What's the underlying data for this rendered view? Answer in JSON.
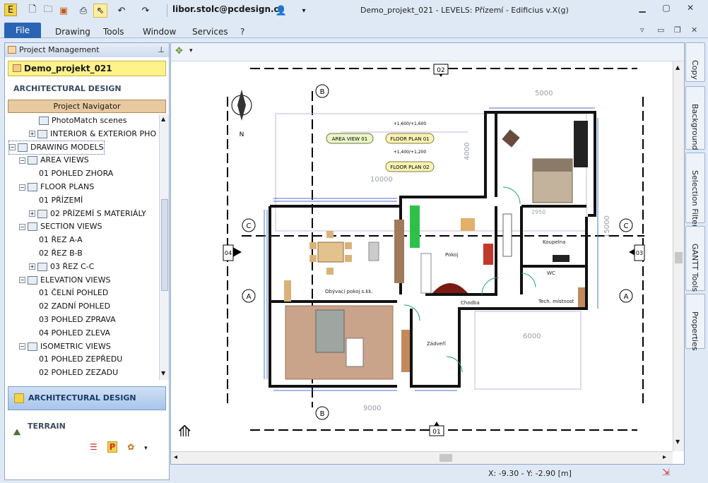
{
  "window": {
    "user": "libor.stolc@pcdesign.cz",
    "title": "Demo_projekt_021 -  LEVELS: Přízemí - Edificius v.X(g)"
  },
  "menu": [
    "File",
    "Drawing",
    "Tools",
    "Window",
    "Services",
    "?"
  ],
  "panel": {
    "header": "Project Management",
    "project": "Demo_projekt_021",
    "section": "ARCHITECTURAL DESIGN",
    "navigator": "Project Navigator",
    "tree": [
      {
        "label": "PhotoMatch scenes",
        "indent": 3,
        "exp": ""
      },
      {
        "label": "INTERIOR & EXTERIOR PHO",
        "indent": 2,
        "exp": "+"
      },
      {
        "label": "DRAWING MODELS",
        "indent": 0,
        "exp": "-"
      },
      {
        "label": "AREA VIEWS",
        "indent": 1,
        "exp": "-"
      },
      {
        "label": "01 POHLED ZHORA",
        "indent": 3,
        "exp": ""
      },
      {
        "label": "FLOOR PLANS",
        "indent": 1,
        "exp": "-"
      },
      {
        "label": "01 PŘÍZEMÍ",
        "indent": 3,
        "exp": ""
      },
      {
        "label": "02 PŘÍZEMÍ S MATERIÁLY",
        "indent": 2,
        "exp": "+"
      },
      {
        "label": "SECTION VIEWS",
        "indent": 1,
        "exp": "-"
      },
      {
        "label": "01 ŘEZ  A-A",
        "indent": 3,
        "exp": ""
      },
      {
        "label": "02 ŘEZ  B-B",
        "indent": 3,
        "exp": ""
      },
      {
        "label": "03 ŘEZ  C-C",
        "indent": 2,
        "exp": "+"
      },
      {
        "label": "ELEVATION VIEWS",
        "indent": 1,
        "exp": "-"
      },
      {
        "label": "01 ČELNÍ POHLED",
        "indent": 3,
        "exp": ""
      },
      {
        "label": "02 ZADNÍ POHLED",
        "indent": 3,
        "exp": ""
      },
      {
        "label": "03 POHLED ZPRAVA",
        "indent": 3,
        "exp": ""
      },
      {
        "label": "04 POHLED ZLEVA",
        "indent": 3,
        "exp": ""
      },
      {
        "label": "ISOMETRIC VIEWS",
        "indent": 1,
        "exp": "-"
      },
      {
        "label": "01 POHLED ZEPŘEDU",
        "indent": 3,
        "exp": ""
      },
      {
        "label": "02 POHLED ZEZADU",
        "indent": 3,
        "exp": ""
      }
    ],
    "btn_arch": "ARCHITECTURAL DESIGN",
    "btn_terrain": "TERRAIN"
  },
  "plan": {
    "markers": {
      "top": "02",
      "bottom": "01",
      "left": "04",
      "right": "03",
      "b": "B",
      "c": "C",
      "a": "A"
    },
    "compass": "N",
    "tags": {
      "area_view": "AREA VIEW  01",
      "floor1": "FLOOR PLAN  01",
      "floor2": "FLOOR PLAN  02"
    },
    "dims": {
      "d5000": "5000",
      "d10000": "10000",
      "d4000": "4000",
      "d2950": "2950",
      "d15000": "15000",
      "d6000": "6000",
      "d9000": "9000"
    },
    "levels": {
      "l1": "+1,600/+1,600",
      "l2": "+1,400/+1,200"
    },
    "rooms": {
      "r1": "Obývací pokoj s.kk.",
      "r2": "Pokoj",
      "r3": "Koupelna",
      "r4": "WC",
      "r5": "Chodba",
      "r6": "Tech. místnost",
      "r7": "Zádveří"
    }
  },
  "right_tabs": [
    "Copy",
    "Background",
    "Selection Filter",
    "GANTT Tools",
    "Properties"
  ],
  "status": {
    "coords": "X: -9.30 - Y: -2.90 [m]"
  }
}
